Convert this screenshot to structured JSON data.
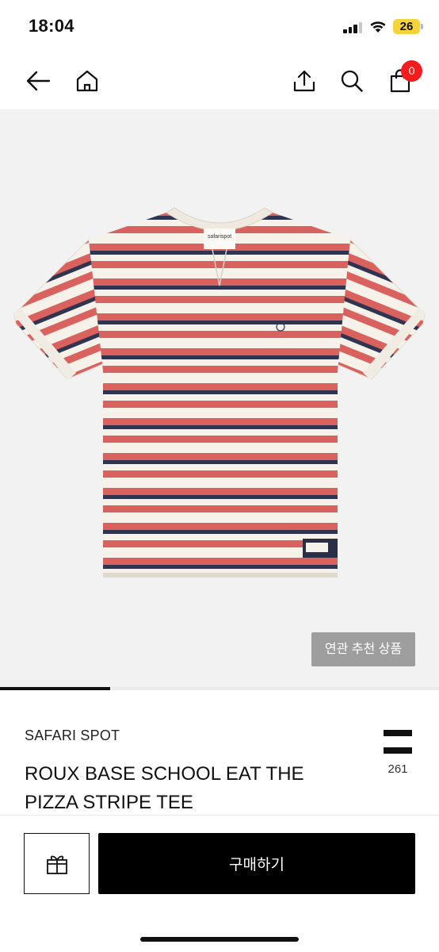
{
  "status_bar": {
    "time": "18:04",
    "battery": "26",
    "icons": [
      "signal-icon",
      "wifi-icon",
      "battery-icon"
    ]
  },
  "nav": {
    "icons": [
      "back-arrow-icon",
      "home-icon",
      "share-icon",
      "search-icon",
      "shopping-bag-icon"
    ],
    "cart_count": "0"
  },
  "product_image": {
    "label_text": "safarispot",
    "related_button": "연관 추천 상품",
    "carousel_progress": 0.25,
    "colors": {
      "stripe_red": "#d9625f",
      "stripe_navy": "#2f3550",
      "base": "#f6f2ea",
      "background": "#f2f2f2"
    }
  },
  "product": {
    "brand": "SAFARI SPOT",
    "title": "ROUX BASE SCHOOL EAT THE PIZZA STRIPE TEE",
    "like_count": "261"
  },
  "bottom_bar": {
    "gift_icon": "gift-icon",
    "buy_label": "구매하기"
  }
}
